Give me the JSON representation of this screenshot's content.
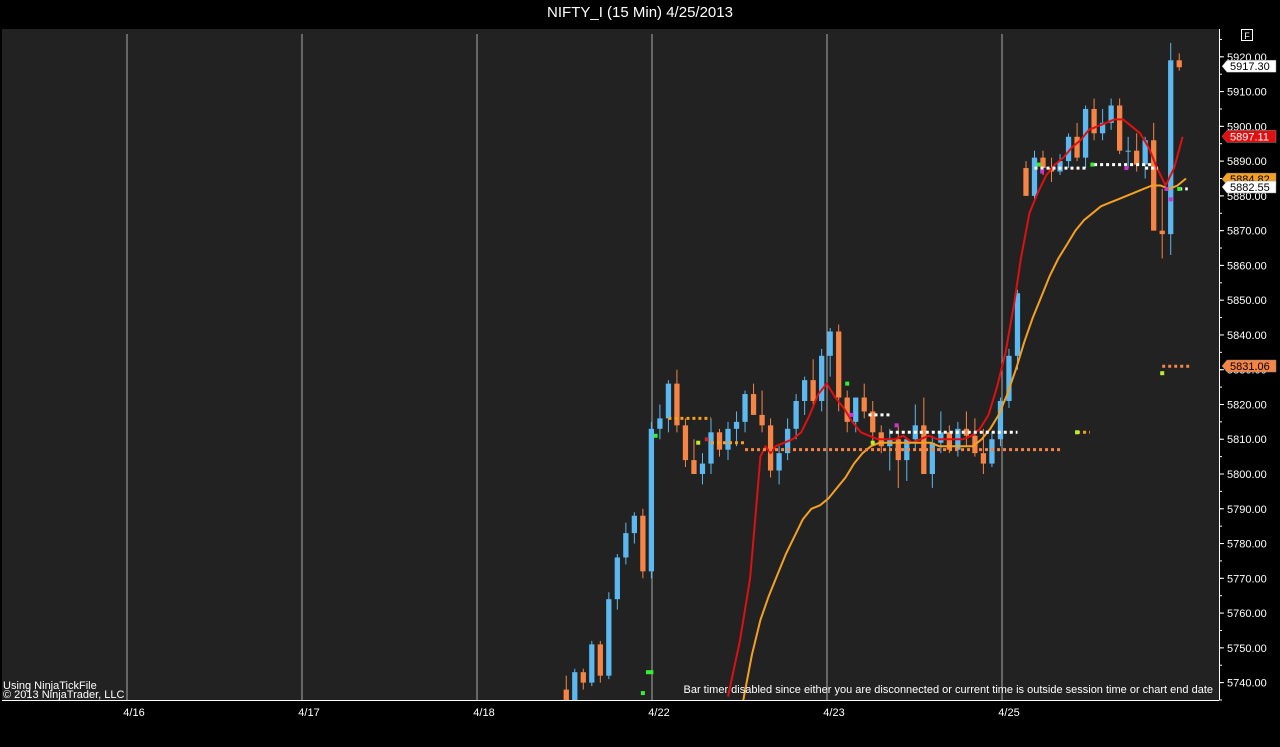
{
  "window": {
    "title": "NIFTY_I (15 Min)  4/25/2013",
    "f_button": "F"
  },
  "notes": {
    "source": "Using NinjaTickFile",
    "copyright": "© 2013 NinjaTrader, LLC",
    "bar_timer": "Bar timer disabled since either you are disconnected or current time is outside session time or chart end date"
  },
  "colors": {
    "background": "#000000",
    "plot_background": "#222222",
    "up_candle": "#5BB8F0",
    "down_candle": "#F58445",
    "ema_fast": "#E01010",
    "ema_slow": "#F5A020",
    "grid": "#cccccc"
  },
  "chart_data": {
    "type": "candlestick",
    "title": "NIFTY_I (15 Min)  4/25/2013",
    "interval": "15 Min",
    "ylim": [
      5735,
      5928
    ],
    "y_ticks": [
      "5740.00",
      "5750.00",
      "5760.00",
      "5770.00",
      "5780.00",
      "5790.00",
      "5800.00",
      "5810.00",
      "5820.00",
      "5830.00",
      "5840.00",
      "5850.00",
      "5860.00",
      "5870.00",
      "5880.00",
      "5890.00",
      "5900.00",
      "5910.00",
      "5920.00"
    ],
    "x_labels": [
      "4/16",
      "4/17",
      "4/18",
      "4/22",
      "4/23",
      "4/25"
    ],
    "price_tags": [
      {
        "label": "5917.30",
        "value": 5917.3,
        "color": "#ffffff",
        "text": "#000000"
      },
      {
        "label": "5897.11",
        "value": 5897.11,
        "color": "#E01010",
        "text": "#ffffff"
      },
      {
        "label": "5884.82",
        "value": 5884.82,
        "color": "#F5A020",
        "text": "#000000"
      },
      {
        "label": "5882.55",
        "value": 5882.55,
        "color": "#ffffff",
        "text": "#000000"
      },
      {
        "label": "5831.06",
        "value": 5831.06,
        "color": "#F58445",
        "text": "#000000"
      }
    ],
    "candles": [
      [
        5738,
        5742,
        5732,
        5734
      ],
      [
        5734,
        5744,
        5733,
        5743
      ],
      [
        5743,
        5744,
        5738,
        5740
      ],
      [
        5740,
        5752,
        5739,
        5751
      ],
      [
        5751,
        5752,
        5740,
        5742
      ],
      [
        5742,
        5766,
        5741,
        5764
      ],
      [
        5764,
        5777,
        5761,
        5776
      ],
      [
        5776,
        5786,
        5774,
        5783
      ],
      [
        5783,
        5789,
        5780,
        5788
      ],
      [
        5788,
        5790,
        5770,
        5772
      ],
      [
        5772,
        5815,
        5770,
        5813
      ],
      [
        5813,
        5820,
        5810,
        5816
      ],
      [
        5816,
        5827,
        5812,
        5826
      ],
      [
        5826,
        5830,
        5812,
        5814
      ],
      [
        5814,
        5816,
        5802,
        5804
      ],
      [
        5804,
        5810,
        5800,
        5800
      ],
      [
        5800,
        5806,
        5797,
        5803
      ],
      [
        5803,
        5816,
        5800,
        5812
      ],
      [
        5812,
        5813,
        5805,
        5807
      ],
      [
        5807,
        5815,
        5804,
        5813
      ],
      [
        5813,
        5818,
        5808,
        5815
      ],
      [
        5815,
        5824,
        5812,
        5823
      ],
      [
        5823,
        5826,
        5817,
        5817
      ],
      [
        5817,
        5824,
        5812,
        5814
      ],
      [
        5814,
        5816,
        5799,
        5801
      ],
      [
        5801,
        5808,
        5797,
        5806
      ],
      [
        5806,
        5816,
        5804,
        5813
      ],
      [
        5813,
        5823,
        5810,
        5821
      ],
      [
        5821,
        5828,
        5817,
        5827
      ],
      [
        5827,
        5833,
        5820,
        5821
      ],
      [
        5821,
        5836,
        5818,
        5834
      ],
      [
        5834,
        5842,
        5828,
        5841
      ],
      [
        5841,
        5843,
        5818,
        5822
      ],
      [
        5822,
        5824,
        5812,
        5815
      ],
      [
        5815,
        5822,
        5812,
        5822
      ],
      [
        5822,
        5826,
        5816,
        5818
      ],
      [
        5818,
        5821,
        5808,
        5812
      ],
      [
        5812,
        5814,
        5806,
        5808
      ],
      [
        5808,
        5813,
        5801,
        5810
      ],
      [
        5810,
        5814,
        5796,
        5804
      ],
      [
        5804,
        5810,
        5798,
        5810
      ],
      [
        5810,
        5820,
        5807,
        5814
      ],
      [
        5814,
        5822,
        5802,
        5800
      ],
      [
        5800,
        5811,
        5796,
        5809
      ],
      [
        5809,
        5818,
        5806,
        5812
      ],
      [
        5812,
        5814,
        5806,
        5807
      ],
      [
        5807,
        5815,
        5805,
        5813
      ],
      [
        5813,
        5818,
        5808,
        5811
      ],
      [
        5811,
        5816,
        5805,
        5806
      ],
      [
        5806,
        5813,
        5800,
        5803
      ],
      [
        5803,
        5812,
        5802,
        5810
      ],
      [
        5810,
        5822,
        5808,
        5821
      ],
      [
        5821,
        5836,
        5819,
        5834
      ],
      [
        5834,
        5853,
        5830,
        5852
      ],
      [
        5888,
        5890,
        5880,
        5880
      ],
      [
        5880,
        5893,
        5879,
        5891
      ],
      [
        5891,
        5893,
        5886,
        5888
      ],
      [
        5888,
        5891,
        5884,
        5887
      ],
      [
        5887,
        5892,
        5886,
        5890
      ],
      [
        5890,
        5898,
        5888,
        5897
      ],
      [
        5897,
        5901,
        5890,
        5891
      ],
      [
        5891,
        5906,
        5888,
        5905
      ],
      [
        5905,
        5908,
        5896,
        5898
      ],
      [
        5898,
        5905,
        5896,
        5901
      ],
      [
        5901,
        5908,
        5899,
        5906
      ],
      [
        5906,
        5908,
        5892,
        5893
      ],
      [
        5893,
        5897,
        5888,
        5893
      ],
      [
        5893,
        5898,
        5887,
        5889
      ],
      [
        5889,
        5897,
        5885,
        5896
      ],
      [
        5896,
        5901,
        5879,
        5870
      ],
      [
        5870,
        5882,
        5862,
        5869
      ],
      [
        5869,
        5924,
        5863,
        5919
      ],
      [
        5919,
        5921,
        5916,
        5917
      ]
    ],
    "series": [
      {
        "name": "ema_fast",
        "color": "#E01010",
        "values": [
          [
            19.0,
            5736
          ],
          [
            20.4,
            5752
          ],
          [
            21.6,
            5770
          ],
          [
            22.3,
            5790
          ],
          [
            22.8,
            5805
          ],
          [
            23.4,
            5808
          ],
          [
            24.0,
            5806
          ],
          [
            24.6,
            5808
          ],
          [
            25.6,
            5809
          ],
          [
            26.6,
            5810
          ],
          [
            27.6,
            5812
          ],
          [
            28.6,
            5817
          ],
          [
            29.6,
            5823
          ],
          [
            30.6,
            5826
          ],
          [
            31.6,
            5822
          ],
          [
            32.6,
            5819
          ],
          [
            33.6,
            5815
          ],
          [
            34.6,
            5812
          ],
          [
            35.6,
            5811
          ],
          [
            36.6,
            5810
          ],
          [
            37.6,
            5810
          ],
          [
            38.6,
            5810
          ],
          [
            39.6,
            5811
          ],
          [
            40.6,
            5809
          ],
          [
            41.6,
            5810
          ],
          [
            42.6,
            5811
          ],
          [
            43.6,
            5810
          ],
          [
            44.6,
            5810
          ],
          [
            45.6,
            5810
          ],
          [
            46.6,
            5810
          ],
          [
            47.6,
            5811
          ],
          [
            48.6,
            5813
          ],
          [
            49.6,
            5817
          ],
          [
            50.6,
            5825
          ],
          [
            51.6,
            5835
          ],
          [
            52.6,
            5849
          ],
          [
            53.4,
            5862
          ],
          [
            54.4,
            5875
          ],
          [
            55.4,
            5881
          ],
          [
            56.4,
            5886
          ],
          [
            57.4,
            5889
          ],
          [
            58.4,
            5891
          ],
          [
            59.4,
            5894
          ],
          [
            60.4,
            5896
          ],
          [
            61.4,
            5899
          ],
          [
            62.4,
            5900
          ],
          [
            63.4,
            5901
          ],
          [
            64.4,
            5902
          ],
          [
            65.4,
            5902
          ],
          [
            66.4,
            5900
          ],
          [
            67.4,
            5898
          ],
          [
            68.4,
            5894
          ],
          [
            69.4,
            5888
          ],
          [
            70.4,
            5883
          ],
          [
            71.4,
            5888
          ],
          [
            72.4,
            5897
          ]
        ]
      },
      {
        "name": "ema_slow",
        "color": "#F5A020",
        "values": [
          [
            20.8,
            5735
          ],
          [
            21.8,
            5748
          ],
          [
            22.8,
            5758
          ],
          [
            23.8,
            5765
          ],
          [
            24.8,
            5771
          ],
          [
            25.8,
            5777
          ],
          [
            26.8,
            5782
          ],
          [
            27.8,
            5787
          ],
          [
            28.8,
            5790
          ],
          [
            29.8,
            5791
          ],
          [
            30.8,
            5793
          ],
          [
            31.8,
            5796
          ],
          [
            32.8,
            5799
          ],
          [
            33.8,
            5803
          ],
          [
            34.8,
            5806
          ],
          [
            35.8,
            5808
          ],
          [
            36.8,
            5809
          ],
          [
            37.8,
            5809
          ],
          [
            38.8,
            5809
          ],
          [
            39.8,
            5809
          ],
          [
            40.8,
            5809
          ],
          [
            41.8,
            5809
          ],
          [
            42.8,
            5809
          ],
          [
            43.8,
            5808
          ],
          [
            44.8,
            5808
          ],
          [
            45.8,
            5808
          ],
          [
            46.8,
            5808
          ],
          [
            47.8,
            5808
          ],
          [
            48.8,
            5810
          ],
          [
            49.8,
            5813
          ],
          [
            50.8,
            5817
          ],
          [
            51.8,
            5823
          ],
          [
            52.8,
            5830
          ],
          [
            53.8,
            5838
          ],
          [
            54.8,
            5845
          ],
          [
            55.8,
            5851
          ],
          [
            56.8,
            5857
          ],
          [
            57.8,
            5862
          ],
          [
            58.8,
            5866
          ],
          [
            59.8,
            5870
          ],
          [
            60.8,
            5873
          ],
          [
            61.8,
            5875
          ],
          [
            62.8,
            5877
          ],
          [
            63.8,
            5878
          ],
          [
            64.8,
            5879
          ],
          [
            65.8,
            5880
          ],
          [
            66.8,
            5881
          ],
          [
            67.8,
            5882
          ],
          [
            68.8,
            5883
          ],
          [
            69.8,
            5883
          ],
          [
            70.8,
            5882
          ],
          [
            71.8,
            5883
          ],
          [
            72.8,
            5885
          ]
        ]
      }
    ],
    "dotted_levels": [
      {
        "start": 12.0,
        "end": 17.0,
        "value": 5816,
        "color": "#F5A020"
      },
      {
        "start": 17.0,
        "end": 21.0,
        "value": 5809,
        "color": "#F5A020"
      },
      {
        "start": 21.0,
        "end": 58.0,
        "value": 5807,
        "color": "#F58445"
      },
      {
        "start": 35.5,
        "end": 38.0,
        "value": 5817,
        "color": "#ffffff"
      },
      {
        "start": 38.0,
        "end": 53.0,
        "value": 5812,
        "color": "#ffffff"
      },
      {
        "start": 55.0,
        "end": 61.0,
        "value": 5888,
        "color": "#ffffff"
      },
      {
        "start": 62.0,
        "end": 69.0,
        "value": 5889,
        "color": "#ffffff"
      },
      {
        "start": 68.0,
        "end": 69.5,
        "value": 5888,
        "color": "#ffffff"
      },
      {
        "start": 60.0,
        "end": 61.5,
        "value": 5812,
        "color": "#F5A020"
      },
      {
        "start": 70.0,
        "end": 73.5,
        "value": 5831,
        "color": "#F58445"
      },
      {
        "start": 72.0,
        "end": 73.0,
        "value": 5882,
        "color": "#ffffff"
      }
    ],
    "markers": [
      {
        "x": 10.0,
        "value": 5743,
        "color": "#33ee33"
      },
      {
        "x": 9.6,
        "value": 5743,
        "color": "#33ee33"
      },
      {
        "x": 9.0,
        "value": 5737,
        "color": "#33ee33"
      },
      {
        "x": 10.5,
        "value": 5811,
        "color": "#33ee33"
      },
      {
        "x": 33.5,
        "value": 5817,
        "color": "#cc33cc"
      },
      {
        "x": 33.0,
        "value": 5826,
        "color": "#33ee33"
      },
      {
        "x": 38.8,
        "value": 5814,
        "color": "#cc33cc"
      },
      {
        "x": 16.5,
        "value": 5810,
        "color": "#cc2222"
      },
      {
        "x": 55.5,
        "value": 5889,
        "color": "#33ee33"
      },
      {
        "x": 55.9,
        "value": 5887,
        "color": "#cc33cc"
      },
      {
        "x": 61.8,
        "value": 5889,
        "color": "#33ee33"
      },
      {
        "x": 65.8,
        "value": 5888,
        "color": "#cc33cc"
      },
      {
        "x": 70.5,
        "value": 5882,
        "color": "#cc33cc"
      },
      {
        "x": 71.0,
        "value": 5879,
        "color": "#cc33cc"
      },
      {
        "x": 72.0,
        "value": 5882,
        "color": "#33ee33"
      },
      {
        "x": 70.0,
        "value": 5829,
        "color": "#bbee33"
      },
      {
        "x": 60.0,
        "value": 5812,
        "color": "#bbee33"
      },
      {
        "x": 36.0,
        "value": 5809,
        "color": "#bbee33"
      },
      {
        "x": 15.5,
        "value": 5809,
        "color": "#bbee33"
      }
    ],
    "x_slot_range": [
      -0.5,
      73.5
    ],
    "session_separators": [
      -18.5,
      -8.7,
      1.2,
      11.0,
      20.9,
      30.8,
      40.7,
      50.6,
      60.5,
      70.4
    ]
  }
}
